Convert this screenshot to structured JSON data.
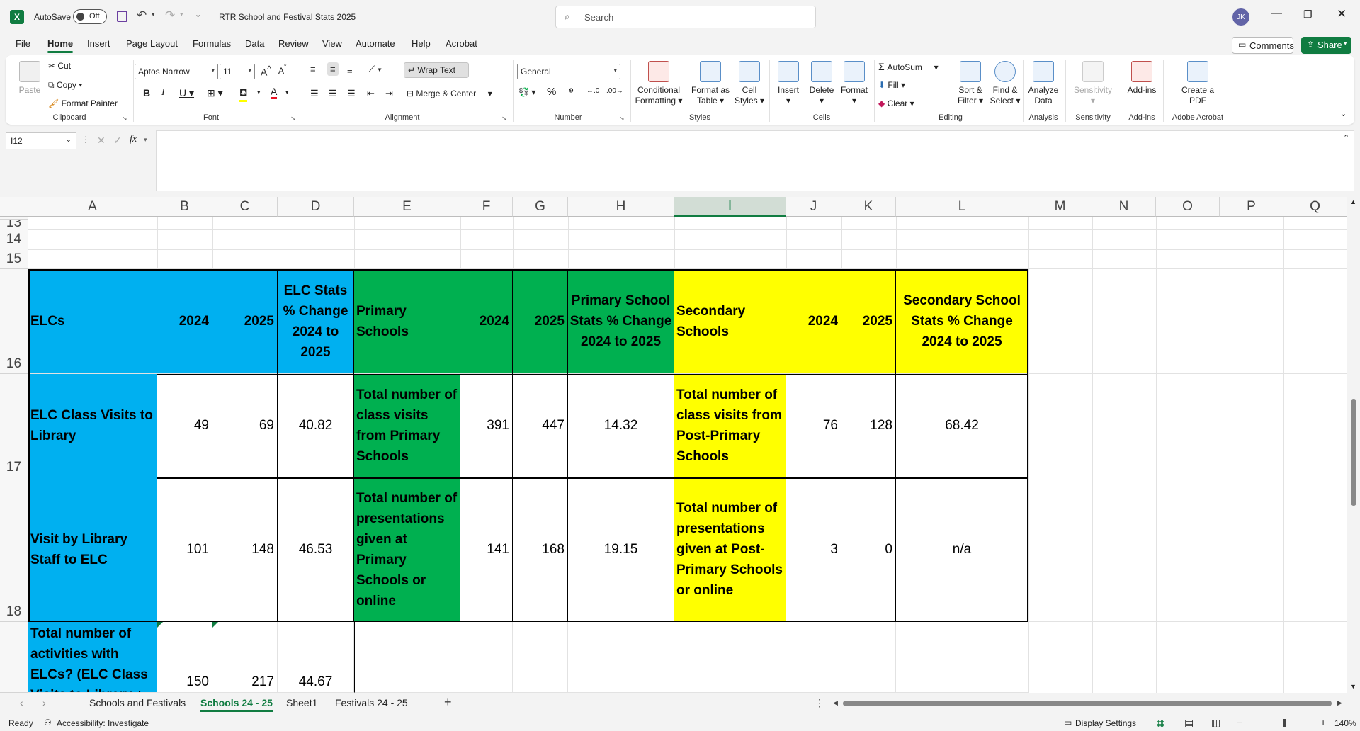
{
  "titlebar": {
    "autosave_label": "AutoSave",
    "autosave_state": "Off",
    "doc_title": "RTR School and Festival Stats 2025",
    "search_placeholder": "Search",
    "avatar_initials": "JK"
  },
  "menu": {
    "tabs": [
      "File",
      "Home",
      "Insert",
      "Page Layout",
      "Formulas",
      "Data",
      "Review",
      "View",
      "Automate",
      "Help",
      "Acrobat"
    ],
    "active": "Home",
    "comments_label": "Comments",
    "share_label": "Share"
  },
  "ribbon": {
    "clipboard": {
      "paste": "Paste",
      "cut": "Cut",
      "copy": "Copy",
      "format_painter": "Format Painter",
      "label": "Clipboard"
    },
    "font": {
      "name": "Aptos Narrow",
      "size": "11",
      "label": "Font"
    },
    "alignment": {
      "wrap": "Wrap Text",
      "merge": "Merge & Center",
      "label": "Alignment"
    },
    "number": {
      "format": "General",
      "label": "Number"
    },
    "styles": {
      "conditional": "Conditional Formatting",
      "format_table": "Format as Table",
      "cell_styles": "Cell Styles",
      "label": "Styles"
    },
    "cells": {
      "insert": "Insert",
      "delete": "Delete",
      "format": "Format",
      "label": "Cells"
    },
    "editing": {
      "autosum": "AutoSum",
      "fill": "Fill",
      "clear": "Clear",
      "sort": "Sort & Filter",
      "find": "Find & Select",
      "label": "Editing"
    },
    "analysis": {
      "analyze": "Analyze Data",
      "label": "Analysis"
    },
    "sensitivity": {
      "btn": "Sensitivity",
      "label": "Sensitivity"
    },
    "addins": {
      "btn": "Add-ins",
      "label": "Add-ins"
    },
    "acrobat": {
      "btn": "Create a PDF",
      "label": "Adobe Acrobat"
    }
  },
  "formula": {
    "name_box": "I12",
    "fx": "fx",
    "content": ""
  },
  "columns": [
    "A",
    "B",
    "C",
    "D",
    "E",
    "F",
    "G",
    "H",
    "I",
    "J",
    "K",
    "L",
    "M",
    "N",
    "O",
    "P",
    "Q"
  ],
  "selected_column": "I",
  "rows": [
    "13",
    "14",
    "15",
    "16",
    "17",
    "18"
  ],
  "table": {
    "header": {
      "a": "ELCs",
      "b": "2024",
      "c": "2025",
      "d": "ELC Stats % Change 2024 to 2025",
      "e": "Primary Schools",
      "f": "2024",
      "g": "2025",
      "h": "Primary School Stats % Change 2024 to 2025",
      "i": "Secondary Schools",
      "j": "2024",
      "k": "2025",
      "l": "Secondary School Stats % Change 2024 to 2025"
    },
    "r17": {
      "a": "ELC Class Visits to Library",
      "b": "49",
      "c": "69",
      "d": "40.82",
      "e": "Total number of class visits from Primary Schools",
      "f": "391",
      "g": "447",
      "h": "14.32",
      "i": "Total number of class visits from Post-Primary Schools",
      "j": "76",
      "k": "128",
      "l": "68.42"
    },
    "r18": {
      "a": "Visit by Library Staff to ELC",
      "b": "101",
      "c": "148",
      "d": "46.53",
      "e": "Total number of presentations given at Primary Schools or online",
      "f": "141",
      "g": "168",
      "h": "19.15",
      "i": "Total number of presentations given at Post-Primary Schools or online",
      "j": "3",
      "k": "0",
      "l": "n/a"
    },
    "r19": {
      "a": "Total number of activities with ELCs? (ELC Class Visits to Library +",
      "b": "150",
      "c": "217",
      "d": "44.67"
    }
  },
  "sheets": [
    "Schools and Festivals",
    "Schools 24 - 25",
    "Sheet1",
    "Festivals 24 - 25"
  ],
  "active_sheet": "Schools 24 - 25",
  "status": {
    "ready": "Ready",
    "accessibility": "Accessibility: Investigate",
    "display_settings": "Display Settings",
    "zoom": "140%"
  },
  "colors": {
    "excel_green": "#107c41",
    "elc_blue": "#00b0f0",
    "primary_green": "#00b050",
    "secondary_yellow": "#ffff00"
  }
}
